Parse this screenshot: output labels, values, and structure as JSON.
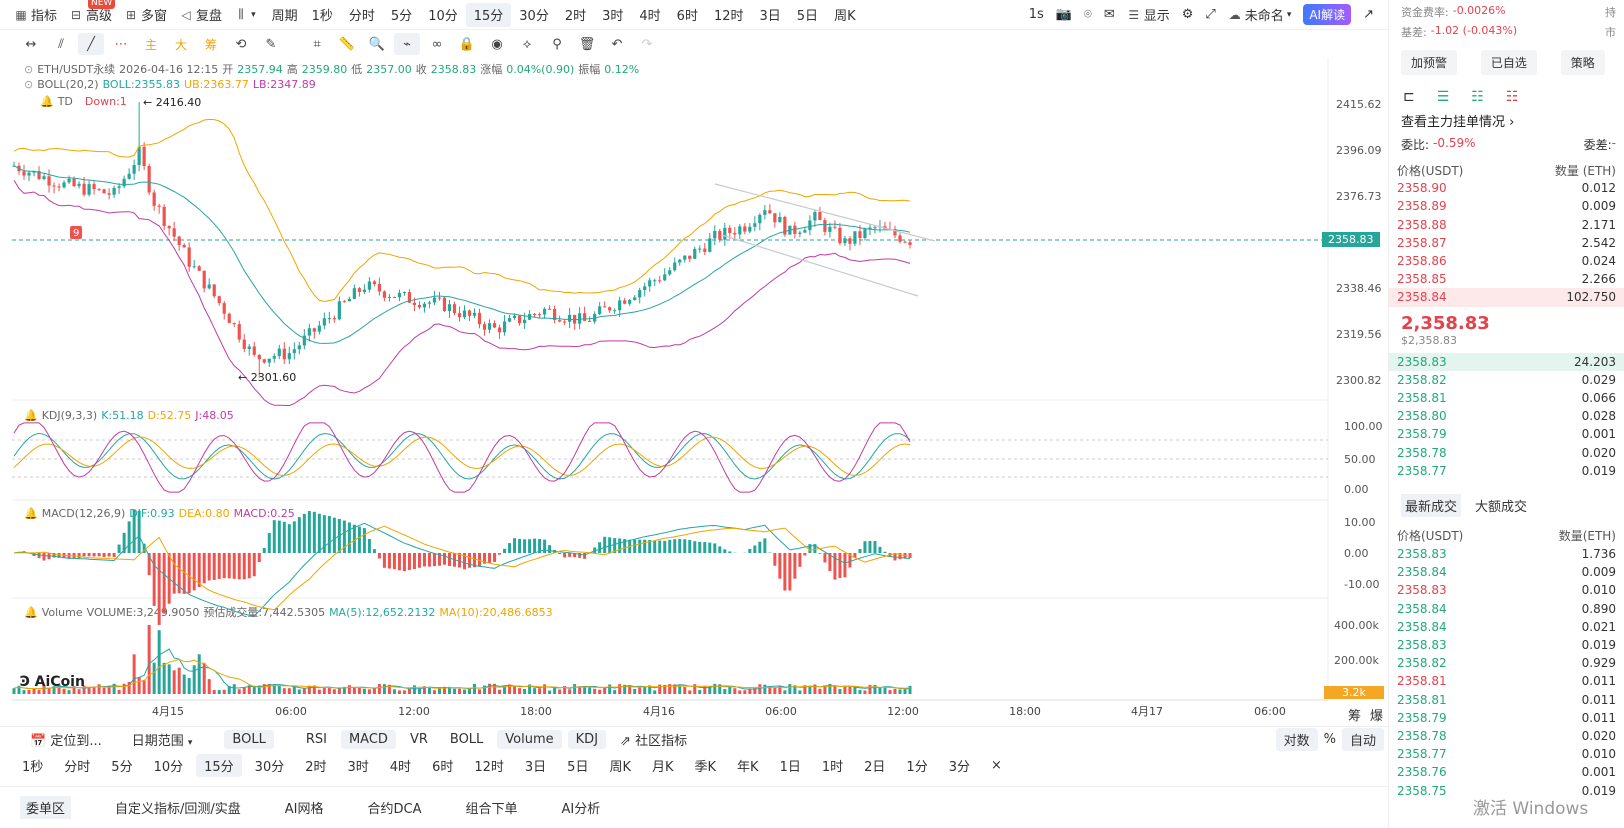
{
  "toolbar": {
    "indicators": "指标",
    "advanced": "高级",
    "new_badge": "NEW",
    "multi_window": "多窗",
    "replay": "复盘",
    "period_label": "周期",
    "periods": [
      "1秒",
      "分时",
      "5分",
      "10分",
      "15分",
      "30分",
      "2时",
      "3时",
      "4时",
      "6时",
      "12时",
      "3日",
      "5日",
      "周K"
    ],
    "active_period": "15分",
    "right": {
      "seconds": "1s",
      "display": "显示",
      "unnamed": "未命名",
      "ai": "AI解读"
    }
  },
  "tools": [
    "主",
    "大",
    "筹"
  ],
  "legend": {
    "symbol": "ETH/USDT永续",
    "time": "2026-04-16 12:15",
    "open_label": "开",
    "open": "2357.94",
    "high_label": "高",
    "high": "2359.80",
    "low_label": "低",
    "low": "2357.00",
    "close_label": "收",
    "close": "2358.83",
    "change_label": "涨幅",
    "change": "0.04%(0.90)",
    "amp_label": "振幅",
    "amp": "0.12%",
    "boll_name": "BOLL(20,2)",
    "boll": "BOLL:2355.83",
    "ub": "UB:2363.77",
    "lb": "LB:2347.89",
    "td_name": "TD",
    "td": "Down:1",
    "kdj_name": "KDJ(9,3,3)",
    "kdj_k": "K:51.18",
    "kdj_d": "D:52.75",
    "kdj_j": "J:48.05",
    "macd_name": "MACD(12,26,9)",
    "dif": "DIF:0.93",
    "dea": "DEA:0.80",
    "macd": "MACD:0.25",
    "vol_name": "Volume",
    "vol": "VOLUME:3,249.9050",
    "vol_est": "预估成交量:7,442.5305",
    "ma5": "MA(5):12,652.2132",
    "ma10": "MA(10):20,486.6853"
  },
  "annotations": {
    "high_mark": "2416.40",
    "low_mark": "2301.60",
    "td_count": "9",
    "logo": "AiCoin"
  },
  "yaxis_main": [
    "2415.62",
    "2396.09",
    "2376.73",
    "2338.46",
    "2319.56",
    "2300.82"
  ],
  "price_tag": "2358.83",
  "yaxis_kdj": [
    "100.00",
    "50.00",
    "0.00"
  ],
  "yaxis_macd": [
    "10.00",
    "0.00",
    "-10.00"
  ],
  "yaxis_vol": [
    "400.00k",
    "200.00k"
  ],
  "vol_tag": "3.2k",
  "xaxis": [
    "4月15",
    "06:00",
    "12:00",
    "18:00",
    "4月16",
    "06:00",
    "12:00",
    "18:00",
    "4月17",
    "06:00"
  ],
  "axis_corner": [
    "筹",
    "爆"
  ],
  "bottom_bar": {
    "locate": "定位到...",
    "range": "日期范围",
    "indicators": [
      "BOLL",
      "RSI",
      "MACD",
      "VR",
      "BOLL",
      "Volume",
      "KDJ"
    ],
    "active": [
      "BOLL",
      "MACD",
      "Volume",
      "KDJ"
    ],
    "community": "社区指标",
    "log": "对数",
    "pct": "%",
    "auto": "自动"
  },
  "period_bar": [
    "1秒",
    "分时",
    "5分",
    "10分",
    "15分",
    "30分",
    "2时",
    "3时",
    "4时",
    "6时",
    "12时",
    "3日",
    "5日",
    "周K",
    "月K",
    "季K",
    "年K",
    "1日",
    "1时",
    "2日",
    "1分",
    "3分"
  ],
  "period_bar_active": "15分",
  "footer_tabs": [
    "委单区",
    "自定义指标/回测/实盘",
    "AI网格",
    "合约DCA",
    "组合下单",
    "AI分析"
  ],
  "side": {
    "funding_label": "资金费率:",
    "funding": "-0.0026%",
    "hold_label": "持",
    "basis_label": "基差:",
    "basis": "-1.02 (-0.043%)",
    "mkt_label": "市",
    "btn_alert": "加预警",
    "btn_fav": "已自选",
    "btn_strategy": "策略",
    "depth_title": "查看主力挂单情况",
    "ratio_label": "委比:",
    "ratio": "-0.59%",
    "diff_label": "委差:",
    "diff_val": "-",
    "col_price": "价格(USDT)",
    "col_qty": "数量 (ETH)",
    "asks": [
      [
        "2358.90",
        "0.012"
      ],
      [
        "2358.89",
        "0.009"
      ],
      [
        "2358.88",
        "2.171"
      ],
      [
        "2358.87",
        "2.542"
      ],
      [
        "2358.86",
        "0.024"
      ],
      [
        "2358.85",
        "2.266"
      ],
      [
        "2358.84",
        "102.750"
      ]
    ],
    "last": "2,358.83",
    "last_usd": "$2,358.83",
    "bids": [
      [
        "2358.83",
        "24.203"
      ],
      [
        "2358.82",
        "0.029"
      ],
      [
        "2358.81",
        "0.066"
      ],
      [
        "2358.80",
        "0.028"
      ],
      [
        "2358.79",
        "0.001"
      ],
      [
        "2358.78",
        "0.020"
      ],
      [
        "2358.77",
        "0.019"
      ]
    ],
    "trade_tab1": "最新成交",
    "trade_tab2": "大额成交",
    "trade_col_price": "价格(USDT)",
    "trade_col_qty": "数量(ETH)",
    "trades": [
      [
        "2358.83",
        "1.736",
        "g"
      ],
      [
        "2358.84",
        "0.009",
        "g"
      ],
      [
        "2358.83",
        "0.010",
        "r"
      ],
      [
        "2358.84",
        "0.890",
        "g"
      ],
      [
        "2358.84",
        "0.021",
        "g"
      ],
      [
        "2358.83",
        "0.019",
        "g"
      ],
      [
        "2358.82",
        "0.929",
        "g"
      ],
      [
        "2358.81",
        "0.011",
        "r"
      ],
      [
        "2358.81",
        "0.011",
        "g"
      ],
      [
        "2358.79",
        "0.011",
        "g"
      ],
      [
        "2358.78",
        "0.020",
        "g"
      ],
      [
        "2358.77",
        "0.010",
        "g"
      ],
      [
        "2358.76",
        "0.001",
        "g"
      ],
      [
        "2358.75",
        "0.019",
        "g"
      ]
    ],
    "watermark": "激活 Windows"
  }
}
